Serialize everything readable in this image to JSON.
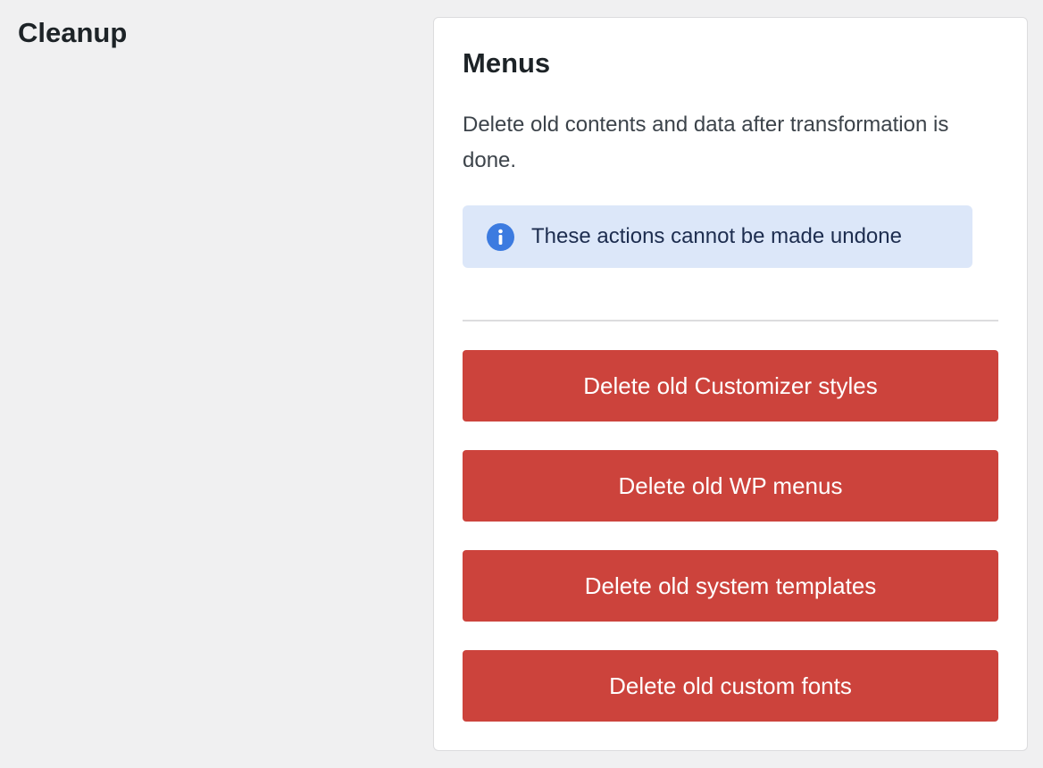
{
  "page": {
    "section_title": "Cleanup"
  },
  "card": {
    "title": "Menus",
    "description": "Delete old contents and data after transformation is done."
  },
  "notice": {
    "icon": "info-icon",
    "text": "These actions cannot be made undone"
  },
  "actions": [
    {
      "label": "Delete old Customizer styles"
    },
    {
      "label": "Delete old WP menus"
    },
    {
      "label": "Delete old system templates"
    },
    {
      "label": "Delete old custom fonts"
    }
  ],
  "colors": {
    "page_background": "#f0f0f1",
    "card_background": "#ffffff",
    "notice_background": "#dce7f9",
    "info_icon": "#3c7be0",
    "danger_button": "#cc433c",
    "button_text": "#ffffff"
  }
}
